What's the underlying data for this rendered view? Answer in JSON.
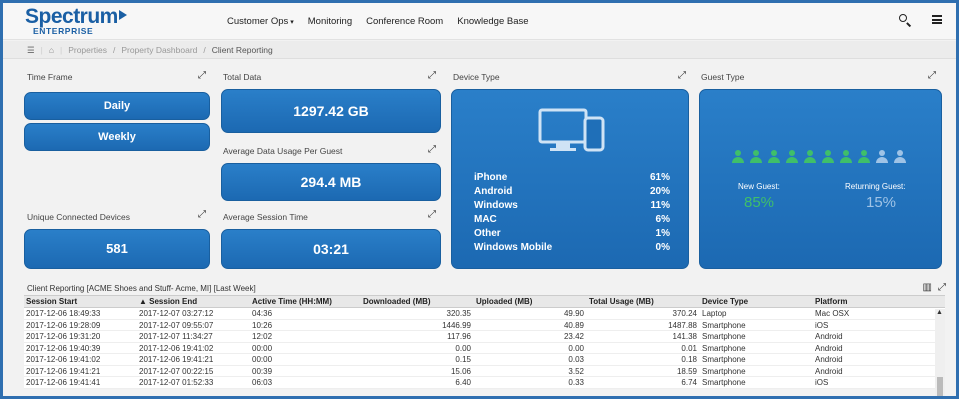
{
  "header": {
    "logo_main": "Spectrum",
    "logo_sub": "ENTERPRISE",
    "nav": [
      "Customer Ops",
      "Monitoring",
      "Conference Room",
      "Knowledge Base"
    ],
    "nav_caret": "▾"
  },
  "breadcrumb": {
    "items": [
      "Properties",
      "Property Dashboard",
      "Client Reporting"
    ],
    "sep": "/"
  },
  "time_frame": {
    "title": "Time Frame",
    "daily": "Daily",
    "weekly": "Weekly"
  },
  "total_data": {
    "title": "Total Data",
    "value": "1297.42 GB"
  },
  "avg_usage": {
    "title": "Average Data Usage Per Guest",
    "value": "294.4 MB"
  },
  "unique_devices": {
    "title": "Unique Connected Devices",
    "value": "581"
  },
  "avg_session": {
    "title": "Average Session Time",
    "value": "03:21"
  },
  "device_type": {
    "title": "Device Type",
    "rows": [
      {
        "label": "iPhone",
        "pct": "61%"
      },
      {
        "label": "Android",
        "pct": "20%"
      },
      {
        "label": "Windows",
        "pct": "11%"
      },
      {
        "label": "MAC",
        "pct": "6%"
      },
      {
        "label": "Other",
        "pct": "1%"
      },
      {
        "label": "Windows Mobile",
        "pct": "0%"
      }
    ]
  },
  "guest_type": {
    "title": "Guest Type",
    "new_label": "New Guest:",
    "new_value": "85%",
    "returning_label": "Returning Guest:",
    "returning_value": "15%",
    "new_color": "#3fbf6a",
    "returning_color": "#9fc3e6"
  },
  "table": {
    "title": "Client Reporting  [ACME Shoes and Stuff- Acme, MI] [Last Week]",
    "headers": [
      "Session Start",
      "▲ Session End",
      "Active Time (HH:MM)",
      "Downloaded (MB)",
      "Uploaded (MB)",
      "Total Usage (MB)",
      "Device Type",
      "Platform"
    ],
    "rows": [
      [
        "2017-12-06 18:49:33",
        "2017-12-07 03:27:12",
        "04:36",
        "320.35",
        "49.90",
        "370.24",
        "Laptop",
        "Mac OSX"
      ],
      [
        "2017-12-06 19:28:09",
        "2017-12-07 09:55:07",
        "10:26",
        "1446.99",
        "40.89",
        "1487.88",
        "Smartphone",
        "iOS"
      ],
      [
        "2017-12-06 19:31:20",
        "2017-12-07 11:34:27",
        "12:02",
        "117.96",
        "23.42",
        "141.38",
        "Smartphone",
        "Android"
      ],
      [
        "2017-12-06 19:40:39",
        "2017-12-06 19:41:02",
        "00:00",
        "0.00",
        "0.00",
        "0.01",
        "Smartphone",
        "Android"
      ],
      [
        "2017-12-06 19:41:02",
        "2017-12-06 19:41:21",
        "00:00",
        "0.15",
        "0.03",
        "0.18",
        "Smartphone",
        "Android"
      ],
      [
        "2017-12-06 19:41:21",
        "2017-12-07 00:22:15",
        "00:39",
        "15.06",
        "3.52",
        "18.59",
        "Smartphone",
        "Android"
      ],
      [
        "2017-12-06 19:41:41",
        "2017-12-07 01:52:33",
        "06:03",
        "6.40",
        "0.33",
        "6.74",
        "Smartphone",
        "iOS"
      ]
    ]
  },
  "colors": {
    "brand": "#1a5fa4",
    "tile": "#1f6fb8",
    "background": "#f2f2f2"
  }
}
